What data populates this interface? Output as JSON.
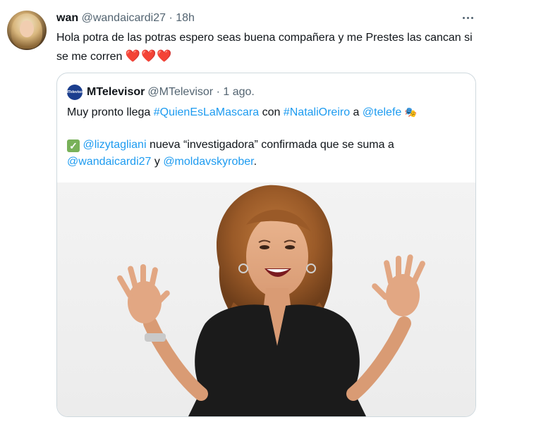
{
  "tweet": {
    "display_name": "wan",
    "handle": "@wandaicardi27",
    "separator": "·",
    "time": "18h",
    "text": "Hola potra de las potras espero seas buena compañera y me Prestes las cancan si se me corren",
    "hearts": "❤️❤️❤️",
    "more_icon": "more-horizontal-icon"
  },
  "quote": {
    "display_name": "MTelevisor",
    "handle": "@MTelevisor",
    "separator": "·",
    "time": "1 ago.",
    "avatar_text": "MTelevisor",
    "line1_prefix": "Muy pronto llega ",
    "hashtag1": "#QuienEsLaMascara",
    "line1_mid": " con ",
    "hashtag2": "#NataliOreiro",
    "line1_mid2": " a ",
    "mention1": "@telefe",
    "line1_emoji": "🎭",
    "check_emoji": "✓",
    "mention2": "@lizytagliani",
    "line2_text": " nueva “investigadora” confirmada que se suma a",
    "mention3": "@wandaicardi27",
    "line3_mid": " y ",
    "mention4": "@moldavskyrober",
    "line3_end": "."
  },
  "colors": {
    "text": "#0f1419",
    "secondary": "#536471",
    "link": "#1d9bf0",
    "heart": "#e0245e",
    "border": "#cfd9de"
  }
}
